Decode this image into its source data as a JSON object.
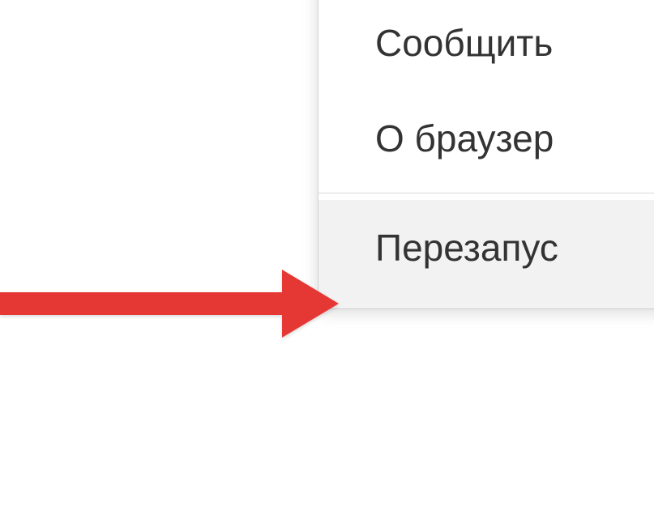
{
  "menu": {
    "items": [
      {
        "label": "Сообщить"
      },
      {
        "label": "О браузер"
      },
      {
        "label": "Перезапус"
      }
    ]
  },
  "arrow": {
    "color": "#e53935"
  }
}
